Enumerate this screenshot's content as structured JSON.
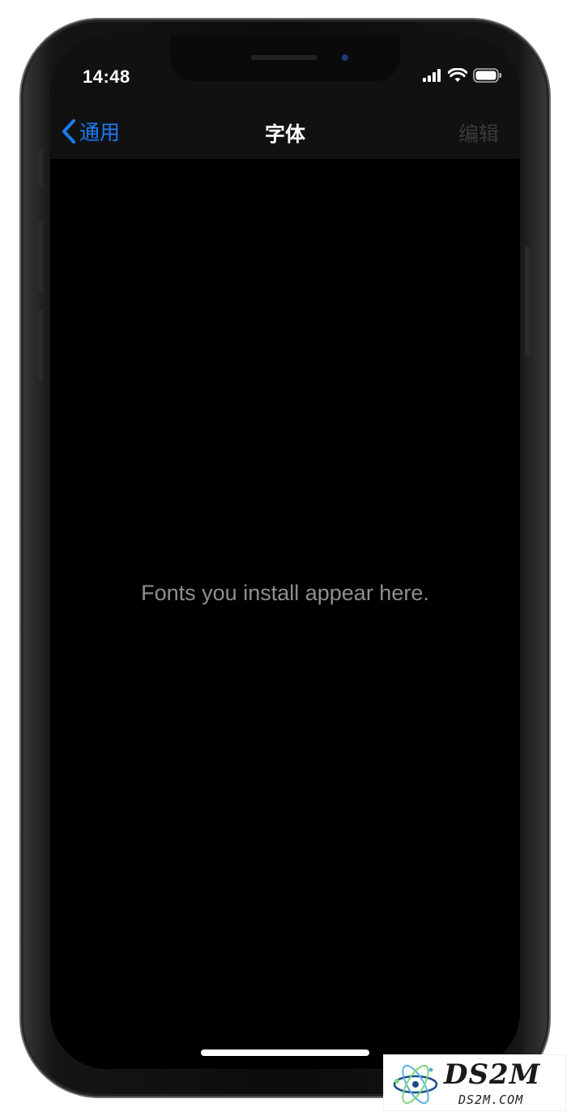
{
  "status_bar": {
    "time": "14:48",
    "icons": [
      "cellular-signal-icon",
      "wifi-icon",
      "battery-icon"
    ]
  },
  "nav": {
    "back_label": "通用",
    "title": "字体",
    "edit_label": "编辑"
  },
  "content": {
    "empty_message": "Fonts you install appear here."
  },
  "watermark": {
    "title": "DS2M",
    "subtitle": "DS2M.COM"
  },
  "colors": {
    "accent": "#1a7cf5",
    "background": "#000000",
    "bar_background": "#111111",
    "secondary_text": "#8e8e93",
    "disabled_text": "#3a3a3c"
  }
}
